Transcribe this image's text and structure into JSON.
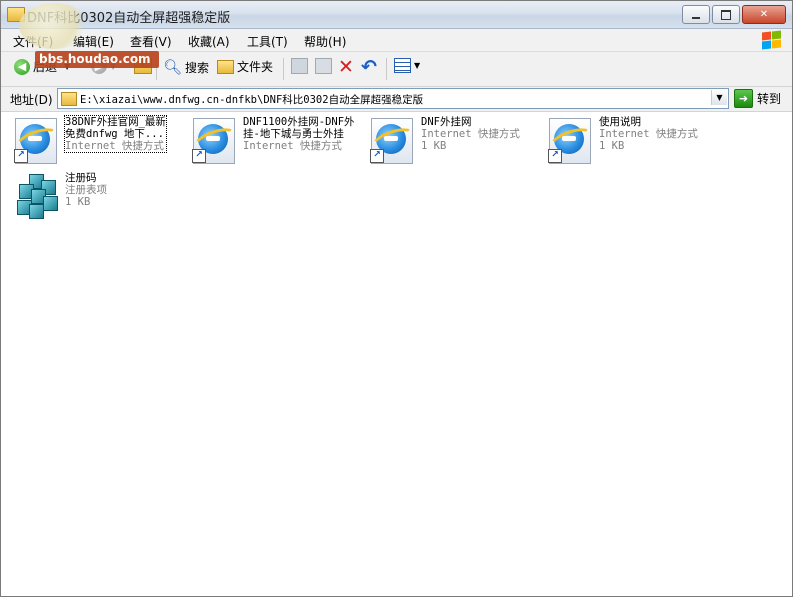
{
  "window": {
    "title": "DNF科比0302自动全屏超强稳定版",
    "controls": {
      "minimize": "minimize",
      "maximize": "maximize",
      "close": "close"
    }
  },
  "menubar": {
    "items": [
      {
        "label": "文件(F)"
      },
      {
        "label": "编辑(E)"
      },
      {
        "label": "查看(V)"
      },
      {
        "label": "收藏(A)"
      },
      {
        "label": "工具(T)"
      },
      {
        "label": "帮助(H)"
      }
    ]
  },
  "watermark": {
    "text": "bbs.houdao.com"
  },
  "toolbar": {
    "back_label": "后退",
    "search_label": "搜索",
    "folders_label": "文件夹"
  },
  "address": {
    "label": "地址(D)",
    "value": "E:\\xiazai\\www.dnfwg.cn-dnfkb\\DNF科比0302自动全屏超强稳定版",
    "go_label": "转到"
  },
  "files": [
    {
      "name_line1": "38DNF外挂官网_最新",
      "name_line2": "免费dnfwg 地下...",
      "type": "Internet 快捷方式",
      "size": "",
      "icon": "ie-shortcut-icon",
      "selected": true
    },
    {
      "name_line1": "DNF1100外挂网-DNF外",
      "name_line2": "挂-地下城与勇士外挂",
      "type": "Internet 快捷方式",
      "size": "",
      "icon": "ie-shortcut-icon",
      "selected": false
    },
    {
      "name_line1": "DNF外挂网",
      "name_line2": "",
      "type": "Internet 快捷方式",
      "size": "1 KB",
      "icon": "ie-shortcut-icon",
      "selected": false
    },
    {
      "name_line1": "使用说明",
      "name_line2": "",
      "type": "Internet 快捷方式",
      "size": "1 KB",
      "icon": "ie-shortcut-icon",
      "selected": false
    },
    {
      "name_line1": "注册码",
      "name_line2": "",
      "type": "注册表项",
      "size": "1 KB",
      "icon": "registry-icon",
      "selected": false
    }
  ],
  "colors": {
    "title_gradient_top": "#e9eef5",
    "close_button": "#c9462c",
    "subtext": "#808080",
    "watermark_bg": "#b8451e"
  }
}
